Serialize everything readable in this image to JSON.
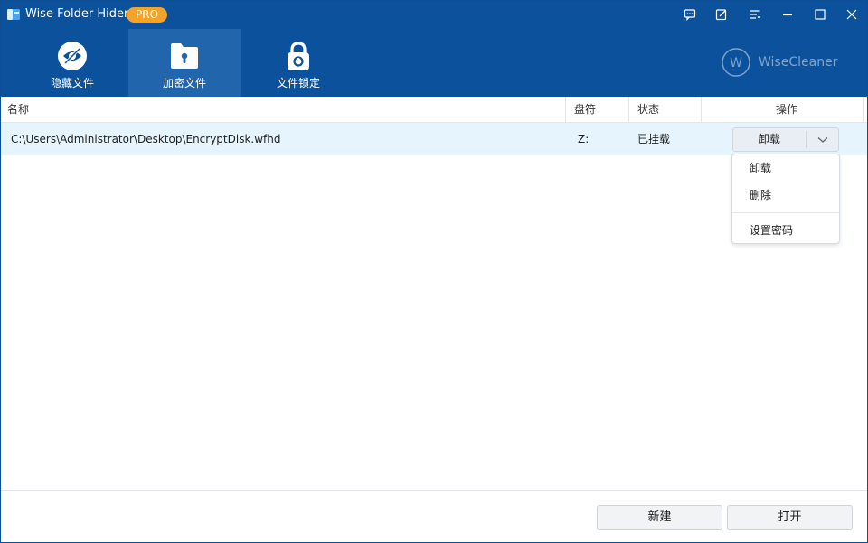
{
  "window": {
    "title": "Wise Folder Hider",
    "badge": "PRO",
    "controls": [
      "feedback-icon",
      "edit-icon",
      "menu-icon",
      "minimize-icon",
      "maximize-icon",
      "close-icon"
    ]
  },
  "nav": {
    "tabs": [
      {
        "label": "隐藏文件",
        "icon": "eye-slash-icon",
        "active": false
      },
      {
        "label": "加密文件",
        "icon": "folder-lock-icon",
        "active": true
      },
      {
        "label": "文件锁定",
        "icon": "padlock-icon",
        "active": false
      }
    ]
  },
  "brand": {
    "text": "WiseCleaner",
    "logo_letter": "W"
  },
  "table": {
    "headers": [
      "名称",
      "盘符",
      "状态",
      "操作"
    ],
    "rows": [
      {
        "path": "C:\\Users\\Administrator\\Desktop\\EncryptDisk.wfhd",
        "drive": "Z:",
        "status": "已挂载",
        "action": "卸载"
      }
    ]
  },
  "dropdown": {
    "items": [
      "卸载",
      "删除",
      "设置密码"
    ]
  },
  "footer": {
    "new_label": "新建",
    "open_label": "打开"
  },
  "colors": {
    "header_bg": "#0b519b",
    "active_tab_bg": "#2166ad",
    "pro_badge": "#f5a326",
    "row_selected": "#e6f5fd"
  }
}
